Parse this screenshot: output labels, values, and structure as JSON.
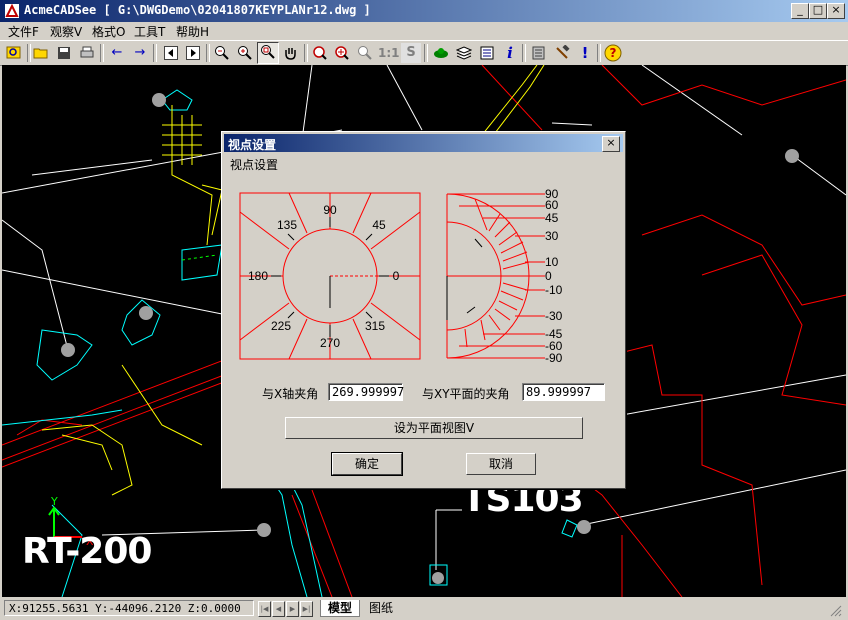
{
  "window": {
    "title": "AcmeCADSee [ G:\\DWGDemo\\02041807KEYPLANr12.dwg ]",
    "controls": [
      "_",
      "□",
      "×"
    ]
  },
  "menu": [
    {
      "label": "文件F"
    },
    {
      "label": "观察V"
    },
    {
      "label": "格式O"
    },
    {
      "label": "工具T"
    },
    {
      "label": "帮助H"
    }
  ],
  "toolbar": {
    "one_to_one_label": "1:1",
    "s_label": "S",
    "info_label": "i",
    "exclaim_label": "!",
    "help_label": "?"
  },
  "drawing": {
    "label_ts103": "TS103",
    "label_rt200": "RT-200",
    "axis_x": "X",
    "axis_y": "Y",
    "colors": {
      "background": "#000000",
      "red": "#ff0000",
      "cyan": "#00ffff",
      "yellow": "#ffff00",
      "white": "#ffffff"
    }
  },
  "dialog": {
    "title": "视点设置",
    "close": "×",
    "group_label": "视点设置",
    "left_dial": {
      "angles": [
        "90",
        "45",
        "135",
        "180",
        "0",
        "225",
        "315",
        "270"
      ]
    },
    "right_dial": {
      "angles": [
        "90",
        "60",
        "45",
        "30",
        "10",
        "0",
        "-10",
        "-30",
        "-45",
        "-60",
        "-90"
      ]
    },
    "x_axis_label": "与X轴夹角",
    "x_axis_value": "269.999997",
    "xy_plane_label": "与XY平面的夹角",
    "xy_plane_value": "89.999997",
    "plan_view_button": "设为平面视图V",
    "ok_button": "确定",
    "cancel_button": "取消"
  },
  "status": {
    "coords": "X:91255.5631 Y:-44096.2120 Z:0.0000",
    "tabs": [
      "模型",
      "图纸"
    ],
    "active_tab": "模型"
  }
}
